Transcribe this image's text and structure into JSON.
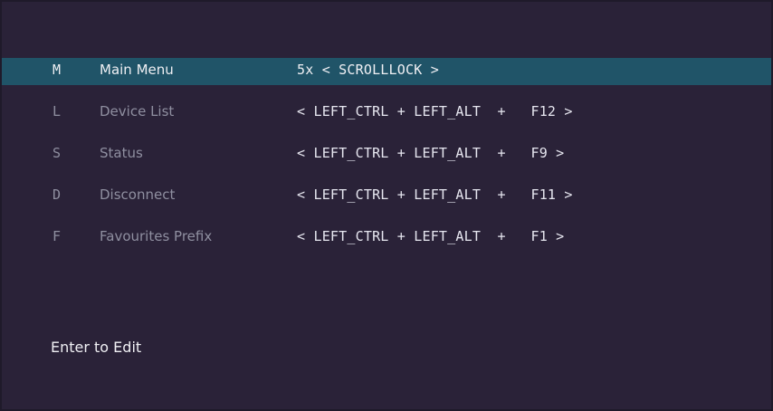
{
  "menu": {
    "items": [
      {
        "key": "M",
        "label": "Main Menu",
        "hotkey": "5x < SCROLLLOCK >",
        "selected": true
      },
      {
        "key": "L",
        "label": "Device List",
        "hotkey": "< LEFT_CTRL + LEFT_ALT  +   F12 >",
        "selected": false
      },
      {
        "key": "S",
        "label": "Status",
        "hotkey": "< LEFT_CTRL + LEFT_ALT  +   F9 >",
        "selected": false
      },
      {
        "key": "D",
        "label": "Disconnect",
        "hotkey": "< LEFT_CTRL + LEFT_ALT  +   F11 >",
        "selected": false
      },
      {
        "key": "F",
        "label": "Favourites Prefix",
        "hotkey": "< LEFT_CTRL + LEFT_ALT  +   F1 >",
        "selected": false
      }
    ]
  },
  "footer": {
    "hint": "Enter to Edit"
  },
  "colors": {
    "background": "#2a2238",
    "selected_row": "#205468",
    "text_bright": "#f0f0f4",
    "text_dim": "#8f8fa0"
  }
}
